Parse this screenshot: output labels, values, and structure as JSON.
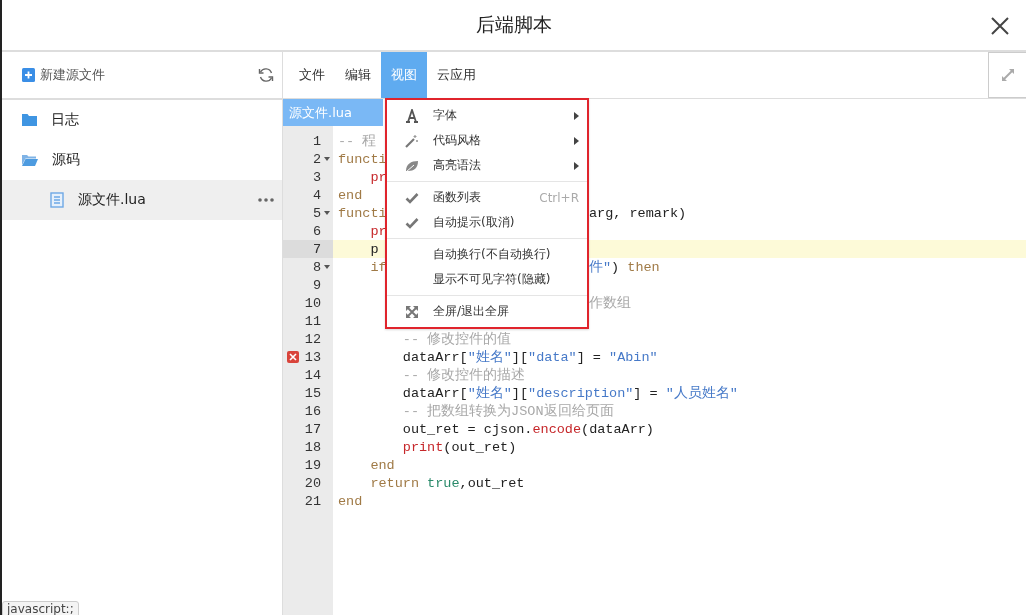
{
  "window": {
    "title": "后端脚本"
  },
  "sidebar": {
    "new_button": "新建源文件",
    "tree": [
      {
        "label": "日志",
        "kind": "folder",
        "expanded": false,
        "selected": false
      },
      {
        "label": "源码",
        "kind": "folder",
        "expanded": true,
        "selected": false,
        "children": [
          {
            "label": "源文件.lua",
            "kind": "file",
            "selected": true
          }
        ]
      }
    ]
  },
  "menubar": [
    {
      "label": "文件",
      "selected": false
    },
    {
      "label": "编辑",
      "selected": false
    },
    {
      "label": "视图",
      "selected": true
    },
    {
      "label": "云应用",
      "selected": false
    }
  ],
  "tabs": [
    {
      "label": "源文件.lua",
      "selected": true
    }
  ],
  "editor": {
    "lines": [
      {
        "number": "1",
        "fold": false,
        "error": false,
        "current": false,
        "left": [
          {
            "kind": "comment",
            "text": "-- 程"
          }
        ]
      },
      {
        "number": "2",
        "fold": true,
        "error": false,
        "current": false,
        "left": [
          {
            "kind": "keyword",
            "text": "functi"
          }
        ]
      },
      {
        "number": "3",
        "fold": false,
        "error": false,
        "current": false,
        "left": [
          {
            "kind": "builtin",
            "text": "    pr"
          }
        ]
      },
      {
        "number": "4",
        "fold": false,
        "error": false,
        "current": false,
        "left": [
          {
            "kind": "keyword",
            "text": "end"
          }
        ]
      },
      {
        "number": "5",
        "fold": true,
        "error": false,
        "current": false,
        "left": [
          {
            "kind": "keyword",
            "text": "functi"
          }
        ],
        "right": [
          {
            "kind": "plain",
            "text": "arg, remark)"
          }
        ]
      },
      {
        "number": "6",
        "fold": false,
        "error": false,
        "current": false,
        "left": [
          {
            "kind": "builtin",
            "text": "    pr"
          }
        ]
      },
      {
        "number": "7",
        "fold": false,
        "error": false,
        "current": true,
        "left": [
          {
            "kind": "plain",
            "text": "    p"
          }
        ]
      },
      {
        "number": "8",
        "fold": true,
        "error": false,
        "current": false,
        "left": [
          {
            "kind": "keyword",
            "text": "    if"
          }
        ],
        "right": [
          {
            "kind": "string",
            "text": "件\""
          },
          {
            "kind": "plain",
            "text": ") "
          },
          {
            "kind": "keyword",
            "text": "then"
          }
        ]
      },
      {
        "number": "9",
        "fold": false,
        "error": false,
        "current": false
      },
      {
        "number": "10",
        "fold": false,
        "error": false,
        "current": false,
        "right": [
          {
            "kind": "comment",
            "text": "作数组"
          }
        ]
      },
      {
        "number": "11",
        "fold": false,
        "error": false,
        "current": false
      },
      {
        "number": "12",
        "fold": false,
        "error": false,
        "current": false,
        "left": [
          {
            "kind": "comment",
            "text": "        -- 修改控件的值"
          }
        ]
      },
      {
        "number": "13",
        "fold": false,
        "error": true,
        "current": false,
        "left": [
          {
            "kind": "plain",
            "text": "        dataArr["
          },
          {
            "kind": "string",
            "text": "\"姓名\""
          },
          {
            "kind": "plain",
            "text": "]["
          },
          {
            "kind": "string",
            "text": "\"data\""
          },
          {
            "kind": "plain",
            "text": "] = "
          },
          {
            "kind": "string",
            "text": "\"Abin\""
          }
        ]
      },
      {
        "number": "14",
        "fold": false,
        "error": false,
        "current": false,
        "left": [
          {
            "kind": "comment",
            "text": "        -- 修改控件的描述"
          }
        ]
      },
      {
        "number": "15",
        "fold": false,
        "error": false,
        "current": false,
        "left": [
          {
            "kind": "plain",
            "text": "        dataArr["
          },
          {
            "kind": "string",
            "text": "\"姓名\""
          },
          {
            "kind": "plain",
            "text": "]["
          },
          {
            "kind": "string",
            "text": "\"description\""
          },
          {
            "kind": "plain",
            "text": "] = "
          },
          {
            "kind": "string",
            "text": "\"人员姓名\""
          }
        ]
      },
      {
        "number": "16",
        "fold": false,
        "error": false,
        "current": false,
        "left": [
          {
            "kind": "comment",
            "text": "        -- 把数组转换为JSON返回给页面"
          }
        ]
      },
      {
        "number": "17",
        "fold": false,
        "error": false,
        "current": false,
        "left": [
          {
            "kind": "plain",
            "text": "        out_ret = cjson."
          },
          {
            "kind": "builtin",
            "text": "encode"
          },
          {
            "kind": "plain",
            "text": "(dataArr)"
          }
        ]
      },
      {
        "number": "18",
        "fold": false,
        "error": false,
        "current": false,
        "left": [
          {
            "kind": "builtin",
            "text": "        print"
          },
          {
            "kind": "plain",
            "text": "(out_ret)"
          }
        ]
      },
      {
        "number": "19",
        "fold": false,
        "error": false,
        "current": false,
        "left": [
          {
            "kind": "keyword",
            "text": "    end"
          }
        ]
      },
      {
        "number": "20",
        "fold": false,
        "error": false,
        "current": false,
        "left": [
          {
            "kind": "keyword",
            "text": "    return"
          },
          {
            "kind": "boolean",
            "text": " true"
          },
          {
            "kind": "plain",
            "text": ",out_ret"
          }
        ]
      },
      {
        "number": "21",
        "fold": false,
        "error": false,
        "current": false,
        "left": [
          {
            "kind": "keyword",
            "text": "end"
          }
        ]
      }
    ]
  },
  "view_menu": {
    "groups": [
      [
        {
          "kind": "submenu",
          "label": "字体"
        },
        {
          "kind": "submenu",
          "label": "代码风格"
        },
        {
          "kind": "submenu",
          "label": "高亮语法"
        }
      ],
      [
        {
          "kind": "toggle",
          "checked": true,
          "label": "函数列表",
          "shortcut": "Ctrl+R"
        },
        {
          "kind": "toggle",
          "checked": true,
          "label": "自动提示(取消)"
        }
      ],
      [
        {
          "kind": "toggle",
          "checked": false,
          "label": "自动换行(不自动换行)"
        },
        {
          "kind": "toggle",
          "checked": false,
          "label": "显示不可见字符(隐藏)"
        }
      ],
      [
        {
          "kind": "action",
          "label": "全屏/退出全屏"
        }
      ]
    ]
  },
  "status_tooltip": "javascript:;"
}
